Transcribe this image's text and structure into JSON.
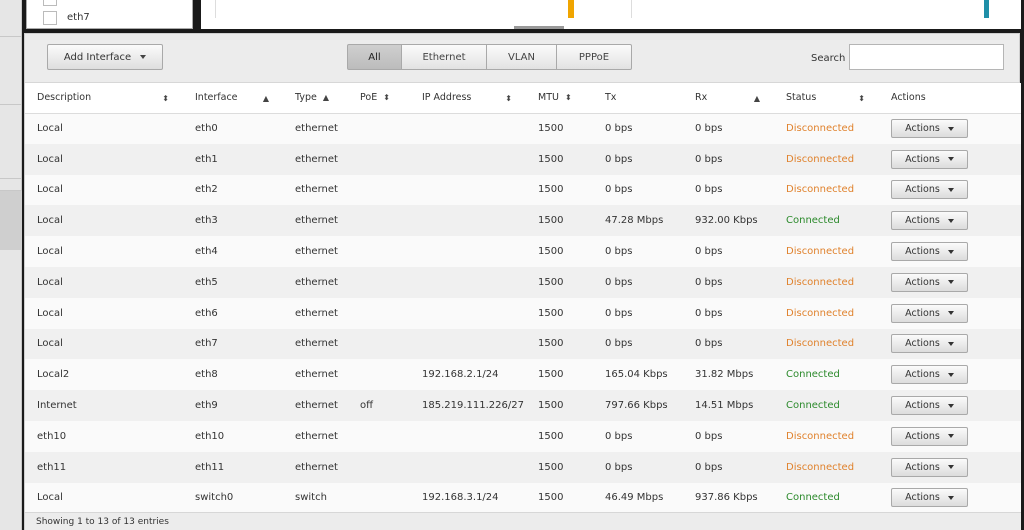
{
  "legend": {
    "last_label": "eth7"
  },
  "chart": {
    "bar_colors": [
      "#f0a500",
      "#1f8fa8"
    ]
  },
  "toolbar": {
    "add_interface_label": "Add Interface",
    "filters": [
      {
        "label": "All",
        "active": true
      },
      {
        "label": "Ethernet",
        "active": false
      },
      {
        "label": "VLAN",
        "active": false
      },
      {
        "label": "PPPoE",
        "active": false
      }
    ],
    "search_label": "Search",
    "search_value": ""
  },
  "table": {
    "columns": [
      "Description",
      "Interface",
      "Type",
      "PoE",
      "IP Address",
      "MTU",
      "Tx",
      "Rx",
      "Status",
      "Actions"
    ],
    "rows": [
      {
        "description": "Local",
        "interface": "eth0",
        "type": "ethernet",
        "poe": "",
        "ip": "",
        "mtu": "1500",
        "tx": "0 bps",
        "rx": "0 bps",
        "status": "Disconnected",
        "action": "Actions"
      },
      {
        "description": "Local",
        "interface": "eth1",
        "type": "ethernet",
        "poe": "",
        "ip": "",
        "mtu": "1500",
        "tx": "0 bps",
        "rx": "0 bps",
        "status": "Disconnected",
        "action": "Actions"
      },
      {
        "description": "Local",
        "interface": "eth2",
        "type": "ethernet",
        "poe": "",
        "ip": "",
        "mtu": "1500",
        "tx": "0 bps",
        "rx": "0 bps",
        "status": "Disconnected",
        "action": "Actions"
      },
      {
        "description": "Local",
        "interface": "eth3",
        "type": "ethernet",
        "poe": "",
        "ip": "",
        "mtu": "1500",
        "tx": "47.28 Mbps",
        "rx": "932.00 Kbps",
        "status": "Connected",
        "action": "Actions"
      },
      {
        "description": "Local",
        "interface": "eth4",
        "type": "ethernet",
        "poe": "",
        "ip": "",
        "mtu": "1500",
        "tx": "0 bps",
        "rx": "0 bps",
        "status": "Disconnected",
        "action": "Actions"
      },
      {
        "description": "Local",
        "interface": "eth5",
        "type": "ethernet",
        "poe": "",
        "ip": "",
        "mtu": "1500",
        "tx": "0 bps",
        "rx": "0 bps",
        "status": "Disconnected",
        "action": "Actions"
      },
      {
        "description": "Local",
        "interface": "eth6",
        "type": "ethernet",
        "poe": "",
        "ip": "",
        "mtu": "1500",
        "tx": "0 bps",
        "rx": "0 bps",
        "status": "Disconnected",
        "action": "Actions"
      },
      {
        "description": "Local",
        "interface": "eth7",
        "type": "ethernet",
        "poe": "",
        "ip": "",
        "mtu": "1500",
        "tx": "0 bps",
        "rx": "0 bps",
        "status": "Disconnected",
        "action": "Actions"
      },
      {
        "description": "Local2",
        "interface": "eth8",
        "type": "ethernet",
        "poe": "",
        "ip": "192.168.2.1/24",
        "mtu": "1500",
        "tx": "165.04 Kbps",
        "rx": "31.82 Mbps",
        "status": "Connected",
        "action": "Actions"
      },
      {
        "description": "Internet",
        "interface": "eth9",
        "type": "ethernet",
        "poe": "off",
        "ip": "185.219.111.226/27",
        "mtu": "1500",
        "tx": "797.66 Kbps",
        "rx": "14.51 Mbps",
        "status": "Connected",
        "action": "Actions"
      },
      {
        "description": "eth10",
        "interface": "eth10",
        "type": "ethernet",
        "poe": "",
        "ip": "",
        "mtu": "1500",
        "tx": "0 bps",
        "rx": "0 bps",
        "status": "Disconnected",
        "action": "Actions"
      },
      {
        "description": "eth11",
        "interface": "eth11",
        "type": "ethernet",
        "poe": "",
        "ip": "",
        "mtu": "1500",
        "tx": "0 bps",
        "rx": "0 bps",
        "status": "Disconnected",
        "action": "Actions"
      },
      {
        "description": "Local",
        "interface": "switch0",
        "type": "switch",
        "poe": "",
        "ip": "192.168.3.1/24",
        "mtu": "1500",
        "tx": "46.49 Mbps",
        "rx": "937.86 Kbps",
        "status": "Connected",
        "action": "Actions"
      }
    ]
  },
  "footer": {
    "info": "Showing 1 to 13 of 13 entries"
  },
  "colors": {
    "connected": "#2c8a2c",
    "disconnected": "#e0822d"
  }
}
